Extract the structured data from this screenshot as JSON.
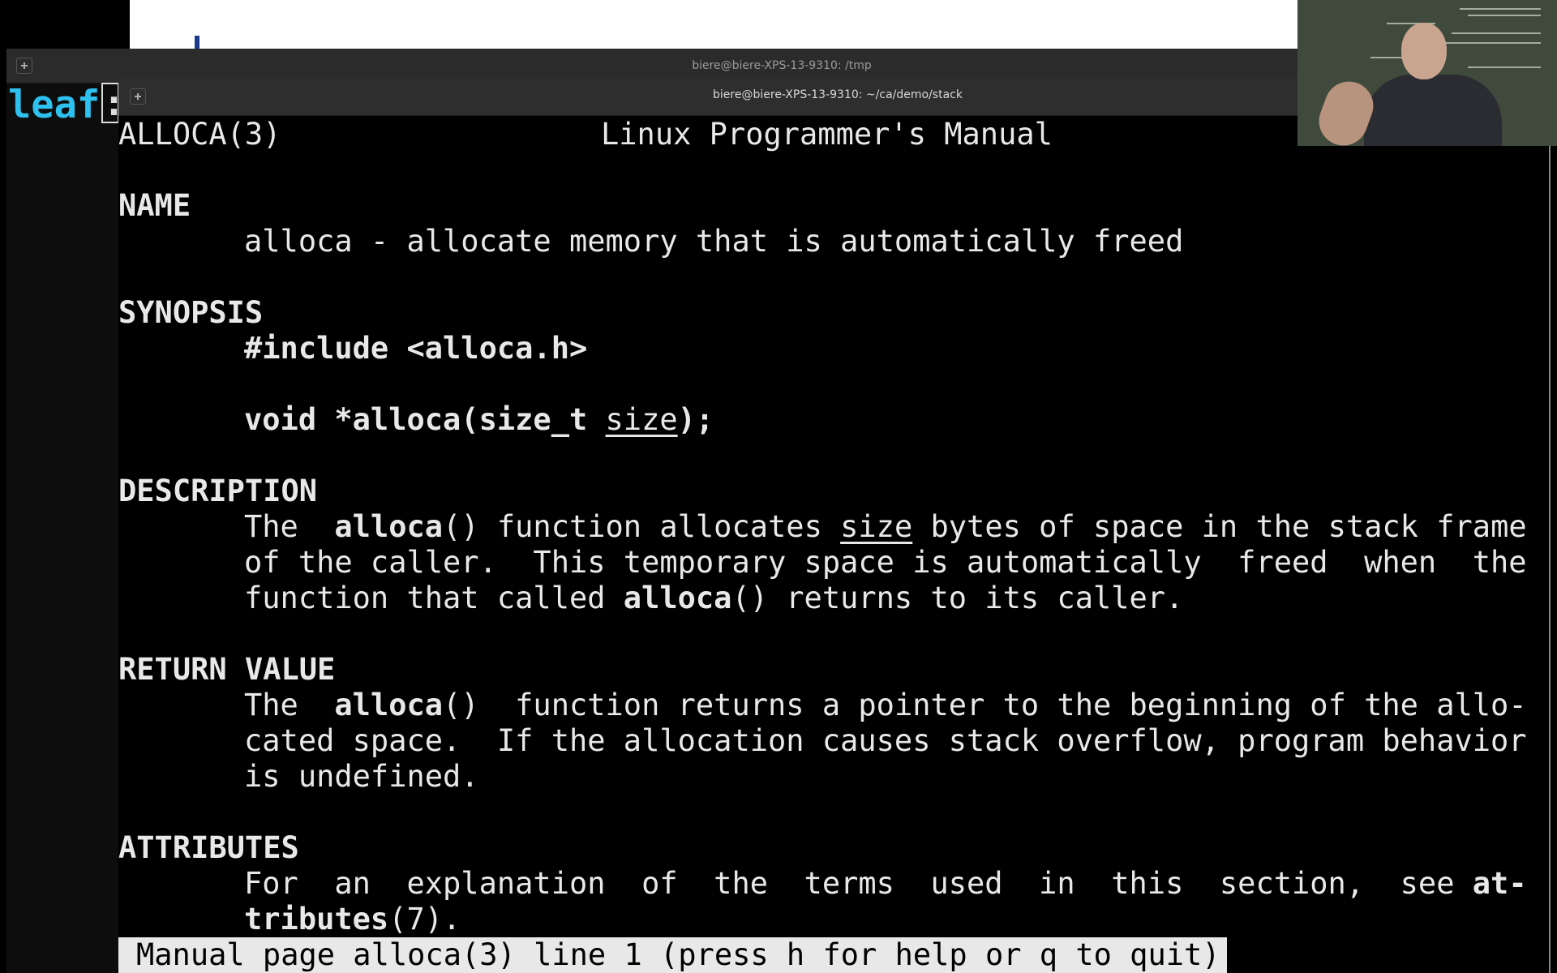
{
  "back_terminal": {
    "title": "biere@biere-XPS-13-9310: /tmp",
    "prompt": "leaf",
    "cursor_char": ":"
  },
  "front_terminal": {
    "title": "biere@biere-XPS-13-9310: ~/ca/demo/stack"
  },
  "man_page": {
    "header_left": "ALLOCA(3)",
    "header_center": "Linux Programmer's Manual",
    "name_heading": "NAME",
    "name_text": "alloca - allocate memory that is automatically freed",
    "synopsis_heading": "SYNOPSIS",
    "synopsis_include": "#include <alloca.h>",
    "synopsis_proto_pre": "void *alloca(size_t ",
    "synopsis_proto_arg": "size",
    "synopsis_proto_post": ");",
    "description_heading": "DESCRIPTION",
    "desc_l1_a": "The  ",
    "desc_l1_b": "alloca",
    "desc_l1_c": "() function allocates ",
    "desc_l1_d": "size",
    "desc_l1_e": " bytes of space in the stack frame",
    "desc_l2": "of the caller.  This temporary space is automatically  freed  when  the",
    "desc_l3_a": "function that called ",
    "desc_l3_b": "alloca",
    "desc_l3_c": "() returns to its caller.",
    "return_heading": "RETURN VALUE",
    "ret_l1_a": "The  ",
    "ret_l1_b": "alloca",
    "ret_l1_c": "()  function returns a pointer to the beginning of the allo-",
    "ret_l2": "cated space.  If the allocation causes stack overflow, program behavior",
    "ret_l3": "is undefined.",
    "attributes_heading": "ATTRIBUTES",
    "attr_l1_a": "For  an  explanation  of  the  terms  used  in  this  section,  see ",
    "attr_l1_b": "at-",
    "attr_l2_a": "tributes",
    "attr_l2_b": "(7)."
  },
  "status_bar": "Manual page alloca(3) line 1 (press h for help or q to quit)"
}
